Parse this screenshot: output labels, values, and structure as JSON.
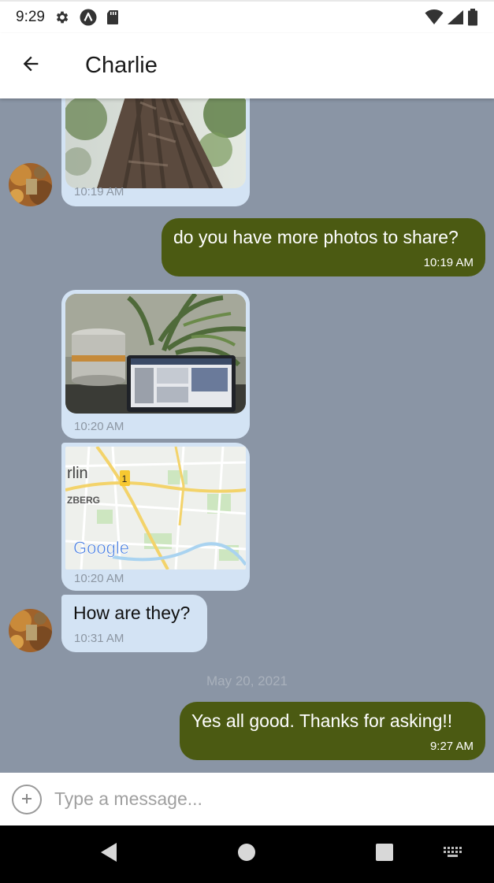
{
  "status_bar": {
    "time": "9:29",
    "icons": [
      "gear-icon",
      "a-badge-icon",
      "sd-card-icon",
      "wifi-icon",
      "signal-icon",
      "battery-icon"
    ]
  },
  "header": {
    "title": "Charlie",
    "back_icon": "arrow-left-icon"
  },
  "messages": [
    {
      "direction": "incoming",
      "kind": "image",
      "content": "tree-bark-photo",
      "time": "10:19 AM"
    },
    {
      "direction": "outgoing",
      "kind": "text",
      "text": "do you have more photos to share?",
      "time": "10:19 AM"
    },
    {
      "direction": "incoming",
      "kind": "image",
      "content": "desk-laptop-photo",
      "time": "10:20 AM"
    },
    {
      "direction": "incoming",
      "kind": "map",
      "content": "map-preview",
      "time": "10:20 AM",
      "map_labels": {
        "place": "rlin",
        "district": "ZBERG",
        "route": "1",
        "brand": "Google"
      }
    },
    {
      "direction": "incoming",
      "kind": "text",
      "text": "How are they?",
      "time": "10:31 AM"
    },
    {
      "direction": "outgoing",
      "kind": "text",
      "text": "Yes all good.  Thanks for asking!!",
      "time": "9:27 AM"
    }
  ],
  "date_separator": "May 20, 2021",
  "composer": {
    "placeholder": "Type a message...",
    "add_icon": "plus-circle-icon"
  },
  "colors": {
    "chat_background": "#8a95a5",
    "incoming_bubble": "#d3e3f4",
    "outgoing_bubble": "#4b5a12"
  }
}
